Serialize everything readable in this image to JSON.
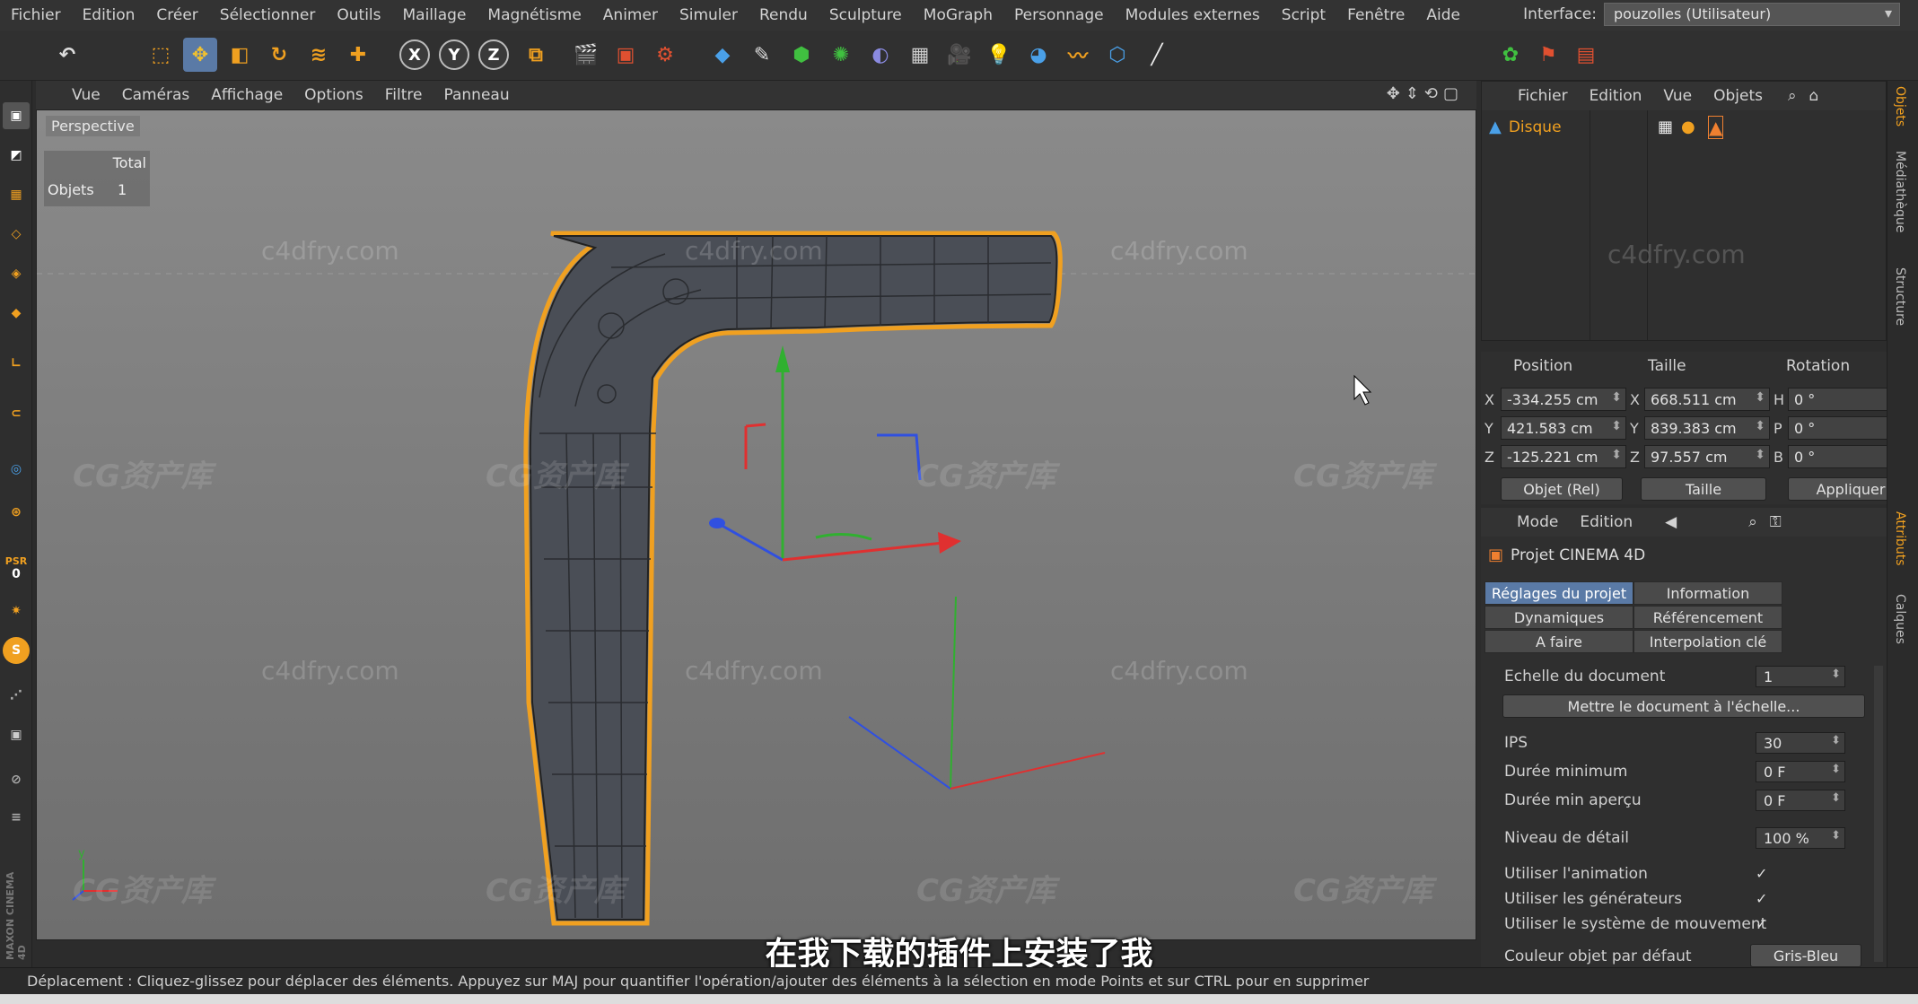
{
  "menubar": {
    "items": [
      "Fichier",
      "Edition",
      "Créer",
      "Sélectionner",
      "Outils",
      "Maillage",
      "Magnétisme",
      "Animer",
      "Simuler",
      "Rendu",
      "Sculpture",
      "MoGraph",
      "Personnage",
      "Modules externes",
      "Script",
      "Fenêtre",
      "Aide"
    ],
    "interface_label": "Interface:",
    "interface_value": "pouzolles (Utilisateur)"
  },
  "toolbar": {
    "axes": [
      "X",
      "Y",
      "Z"
    ]
  },
  "left_toolbar": {
    "psr_label": "PSR",
    "psr_value": "0"
  },
  "viewport": {
    "menu": [
      "Vue",
      "Caméras",
      "Affichage",
      "Options",
      "Filtre",
      "Panneau"
    ],
    "label": "Perspective",
    "stats": {
      "header": "Total",
      "row_label": "Objets",
      "row_value": "1"
    },
    "watermarks": [
      "c4dfry.com",
      "CG资产库"
    ]
  },
  "object_manager": {
    "menu": [
      "Fichier",
      "Edition",
      "Vue",
      "Objets"
    ],
    "object_name": "Disque"
  },
  "coordinates": {
    "headers": [
      "Position",
      "Taille",
      "Rotation"
    ],
    "rows": [
      {
        "axis": "X",
        "pos": "-334.255 cm",
        "size_axis": "X",
        "size": "668.511 cm",
        "rot_axis": "H",
        "rot": "0 °"
      },
      {
        "axis": "Y",
        "pos": "421.583 cm",
        "size_axis": "Y",
        "size": "839.383 cm",
        "rot_axis": "P",
        "rot": "0 °"
      },
      {
        "axis": "Z",
        "pos": "-125.221 cm",
        "size_axis": "Z",
        "size": "97.557 cm",
        "rot_axis": "B",
        "rot": "0 °"
      }
    ],
    "mode_select": "Objet (Rel)",
    "size_select": "Taille",
    "apply_button": "Appliquer"
  },
  "attributes": {
    "menu": [
      "Mode",
      "Edition"
    ],
    "title": "Projet CINEMA 4D",
    "tabs": [
      [
        "Réglages du projet",
        "Information"
      ],
      [
        "Dynamiques",
        "Référencement"
      ],
      [
        "A faire",
        "Interpolation clé"
      ]
    ],
    "doc_scale_label": "Echelle du document",
    "doc_scale_value": "1",
    "scale_button": "Mettre le document à l'échelle...",
    "params": [
      {
        "label": "IPS",
        "value": "30"
      },
      {
        "label": "Durée minimum",
        "value": "0 F"
      },
      {
        "label": "Durée min aperçu",
        "value": "0 F"
      },
      {
        "label": "Niveau de détail",
        "value": "100 %"
      }
    ],
    "checks": [
      "Utiliser l'animation",
      "Utiliser les générateurs",
      "Utiliser le système de mouvement"
    ],
    "color_label": "Couleur objet par défaut",
    "color_value": "Gris-Bleu"
  },
  "right_tabs": [
    "Objets",
    "Médiathèque",
    "Structure",
    "Attributs",
    "Calques"
  ],
  "subtitle": "在我下载的插件上安装了我",
  "status": "Déplacement : Cliquez-glissez pour déplacer des éléments. Appuyez sur MAJ pour quantifier l'opération/ajouter des éléments à la sélection en mode Points et sur CTRL pour en supprimer",
  "colors": {
    "selection": "#f0a020",
    "axis_x": "#e03030",
    "axis_y": "#30b030",
    "axis_z": "#3050e0",
    "active_tab": "#5a7aa6"
  }
}
